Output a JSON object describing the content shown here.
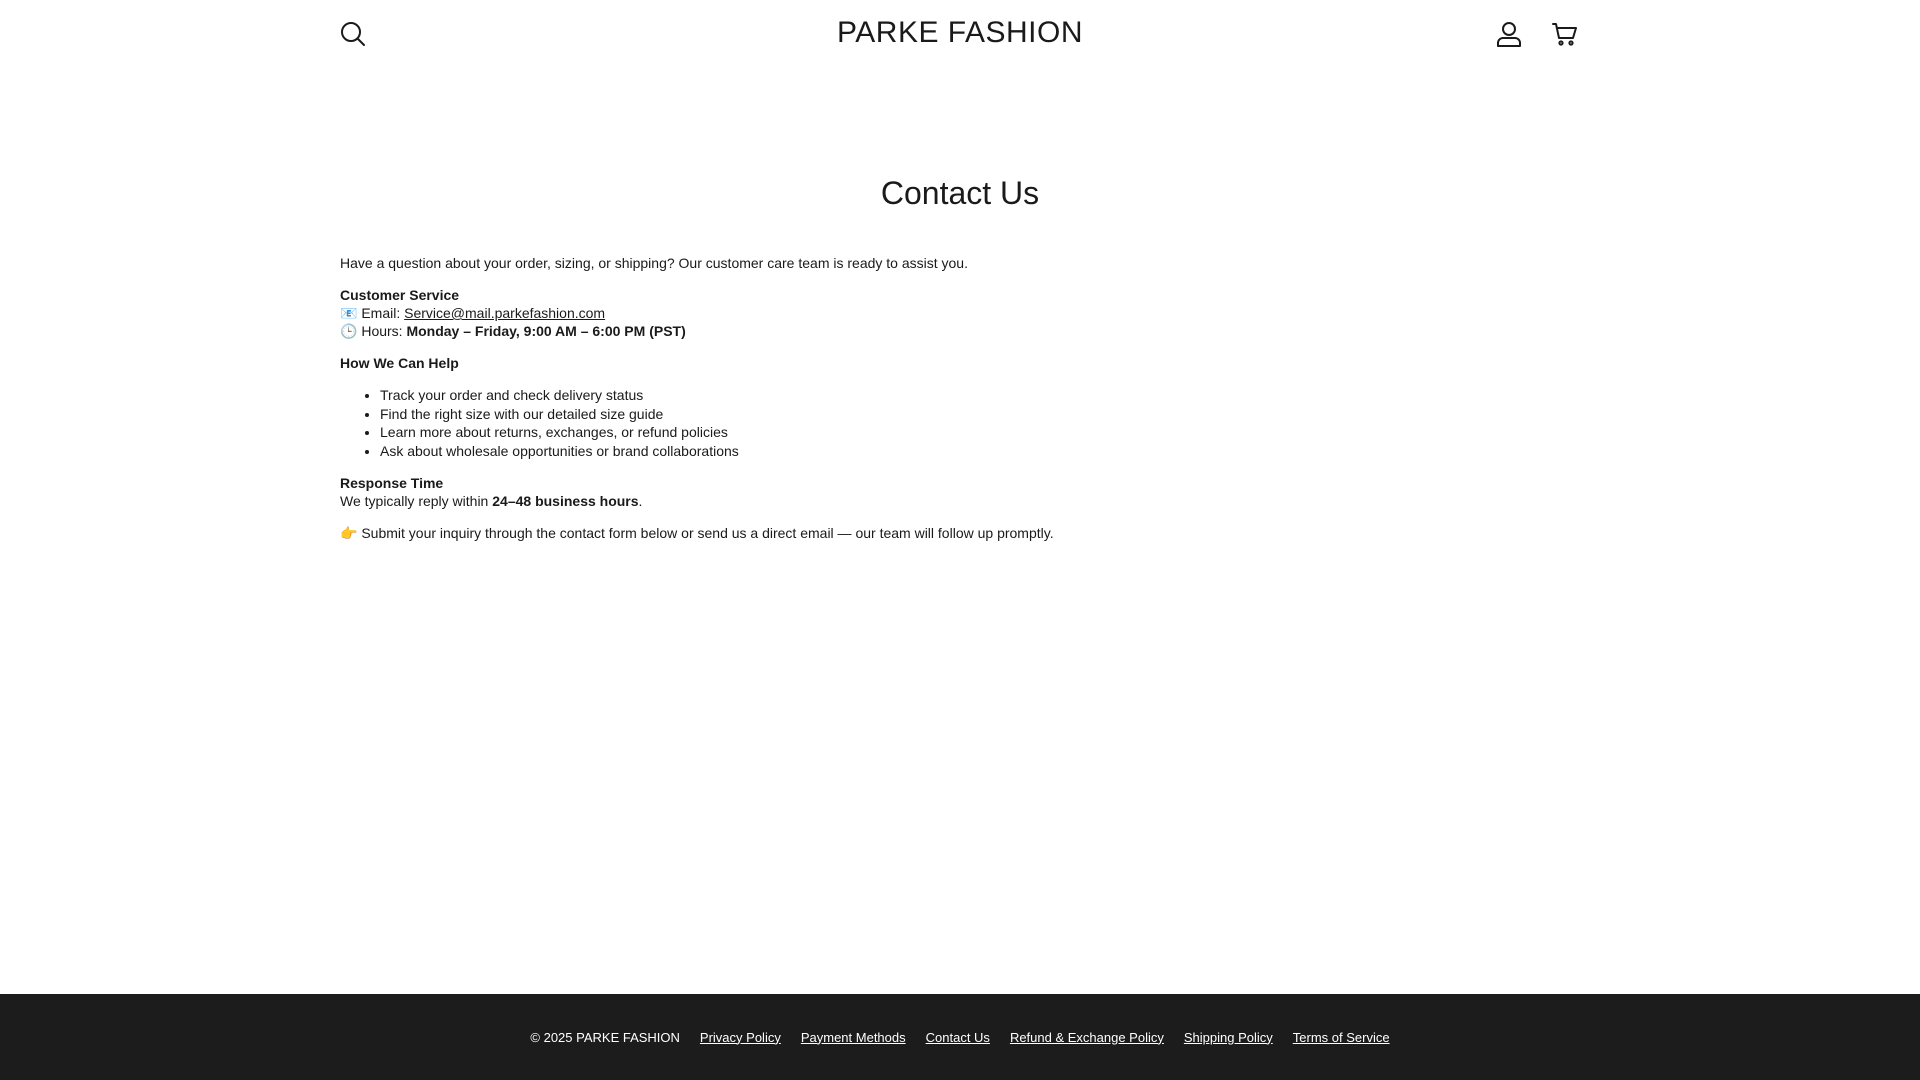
{
  "header": {
    "logo": "PARKE FASHION",
    "icons": {
      "search": "search-icon",
      "account": "user-icon",
      "cart": "cart-icon"
    }
  },
  "main": {
    "title": "Contact Us",
    "intro": "Have a question about your order, sizing, or shipping? Our customer care team is ready to assist you.",
    "customer_service": {
      "heading": "Customer Service",
      "email_emoji": "📧",
      "email_label": "Email:",
      "email": "Service@mail.parkefashion.com",
      "hours_emoji": "🕒",
      "hours_label": "Hours:",
      "hours": "Monday – Friday, 9:00 AM – 6:00 PM (PST)"
    },
    "help": {
      "heading": "How We Can Help",
      "items": [
        "Track your order and check delivery status",
        "Find the right size with our detailed size guide",
        "Learn more about returns, exchanges, or refund policies",
        "Ask about wholesale opportunities or brand collaborations"
      ]
    },
    "response": {
      "heading": "Response Time",
      "text_before": "We typically reply within",
      "bold": "24–48 business hours",
      "text_after": "."
    },
    "cta": {
      "emoji": "👉",
      "text": "Submit your inquiry through the contact form below or send us a direct email — our team will follow up promptly."
    }
  },
  "footer": {
    "copyright": "© 2025 PARKE FASHION",
    "links": [
      "Privacy Policy",
      "Payment Methods",
      "Contact Us",
      "Refund & Exchange Policy",
      "Shipping Policy",
      "Terms of Service"
    ]
  },
  "colors": {
    "text": "#1a1a1a",
    "background": "#ffffff",
    "footer_bg": "#1c1c1c",
    "footer_text": "#ffffff"
  }
}
